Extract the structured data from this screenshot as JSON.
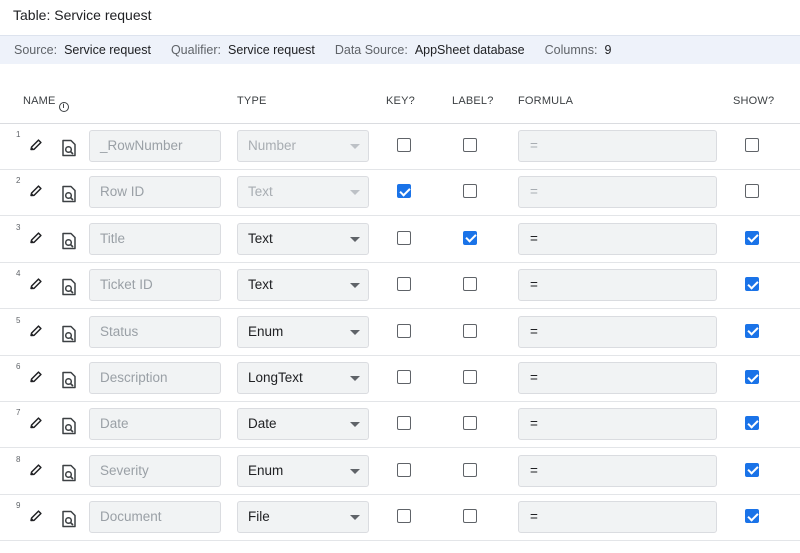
{
  "title": "Table: Service request",
  "info": {
    "source_label": "Source:",
    "source_value": "Service request",
    "qualifier_label": "Qualifier:",
    "qualifier_value": "Service request",
    "datasource_label": "Data Source:",
    "datasource_value": "AppSheet database",
    "columns_label": "Columns:",
    "columns_value": "9"
  },
  "headers": {
    "name": "NAME",
    "type": "TYPE",
    "key": "KEY?",
    "label": "LABEL?",
    "formula": "FORMULA",
    "show": "SHOW?"
  },
  "icons": {
    "edit": "pencil-icon",
    "preview": "document-search-icon",
    "info": "info-icon",
    "dropdown": "caret-down-icon"
  },
  "colors": {
    "accent": "#1a73e8",
    "info_strip_bg": "#eef2fa",
    "field_bg": "#f1f3f4"
  },
  "rows": [
    {
      "num": "1",
      "name": "_RowNumber",
      "type": "Number",
      "formula": "=",
      "key": false,
      "label": false,
      "show": false,
      "editable": false
    },
    {
      "num": "2",
      "name": "Row ID",
      "type": "Text",
      "formula": "=",
      "key": true,
      "label": false,
      "show": false,
      "editable": false
    },
    {
      "num": "3",
      "name": "Title",
      "type": "Text",
      "formula": "=",
      "key": false,
      "label": true,
      "show": true,
      "editable": true
    },
    {
      "num": "4",
      "name": "Ticket ID",
      "type": "Text",
      "formula": "=",
      "key": false,
      "label": false,
      "show": true,
      "editable": true
    },
    {
      "num": "5",
      "name": "Status",
      "type": "Enum",
      "formula": "=",
      "key": false,
      "label": false,
      "show": true,
      "editable": true
    },
    {
      "num": "6",
      "name": "Description",
      "type": "LongText",
      "formula": "=",
      "key": false,
      "label": false,
      "show": true,
      "editable": true
    },
    {
      "num": "7",
      "name": "Date",
      "type": "Date",
      "formula": "=",
      "key": false,
      "label": false,
      "show": true,
      "editable": true
    },
    {
      "num": "8",
      "name": "Severity",
      "type": "Enum",
      "formula": "=",
      "key": false,
      "label": false,
      "show": true,
      "editable": true
    },
    {
      "num": "9",
      "name": "Document",
      "type": "File",
      "formula": "=",
      "key": false,
      "label": false,
      "show": true,
      "editable": true
    }
  ]
}
